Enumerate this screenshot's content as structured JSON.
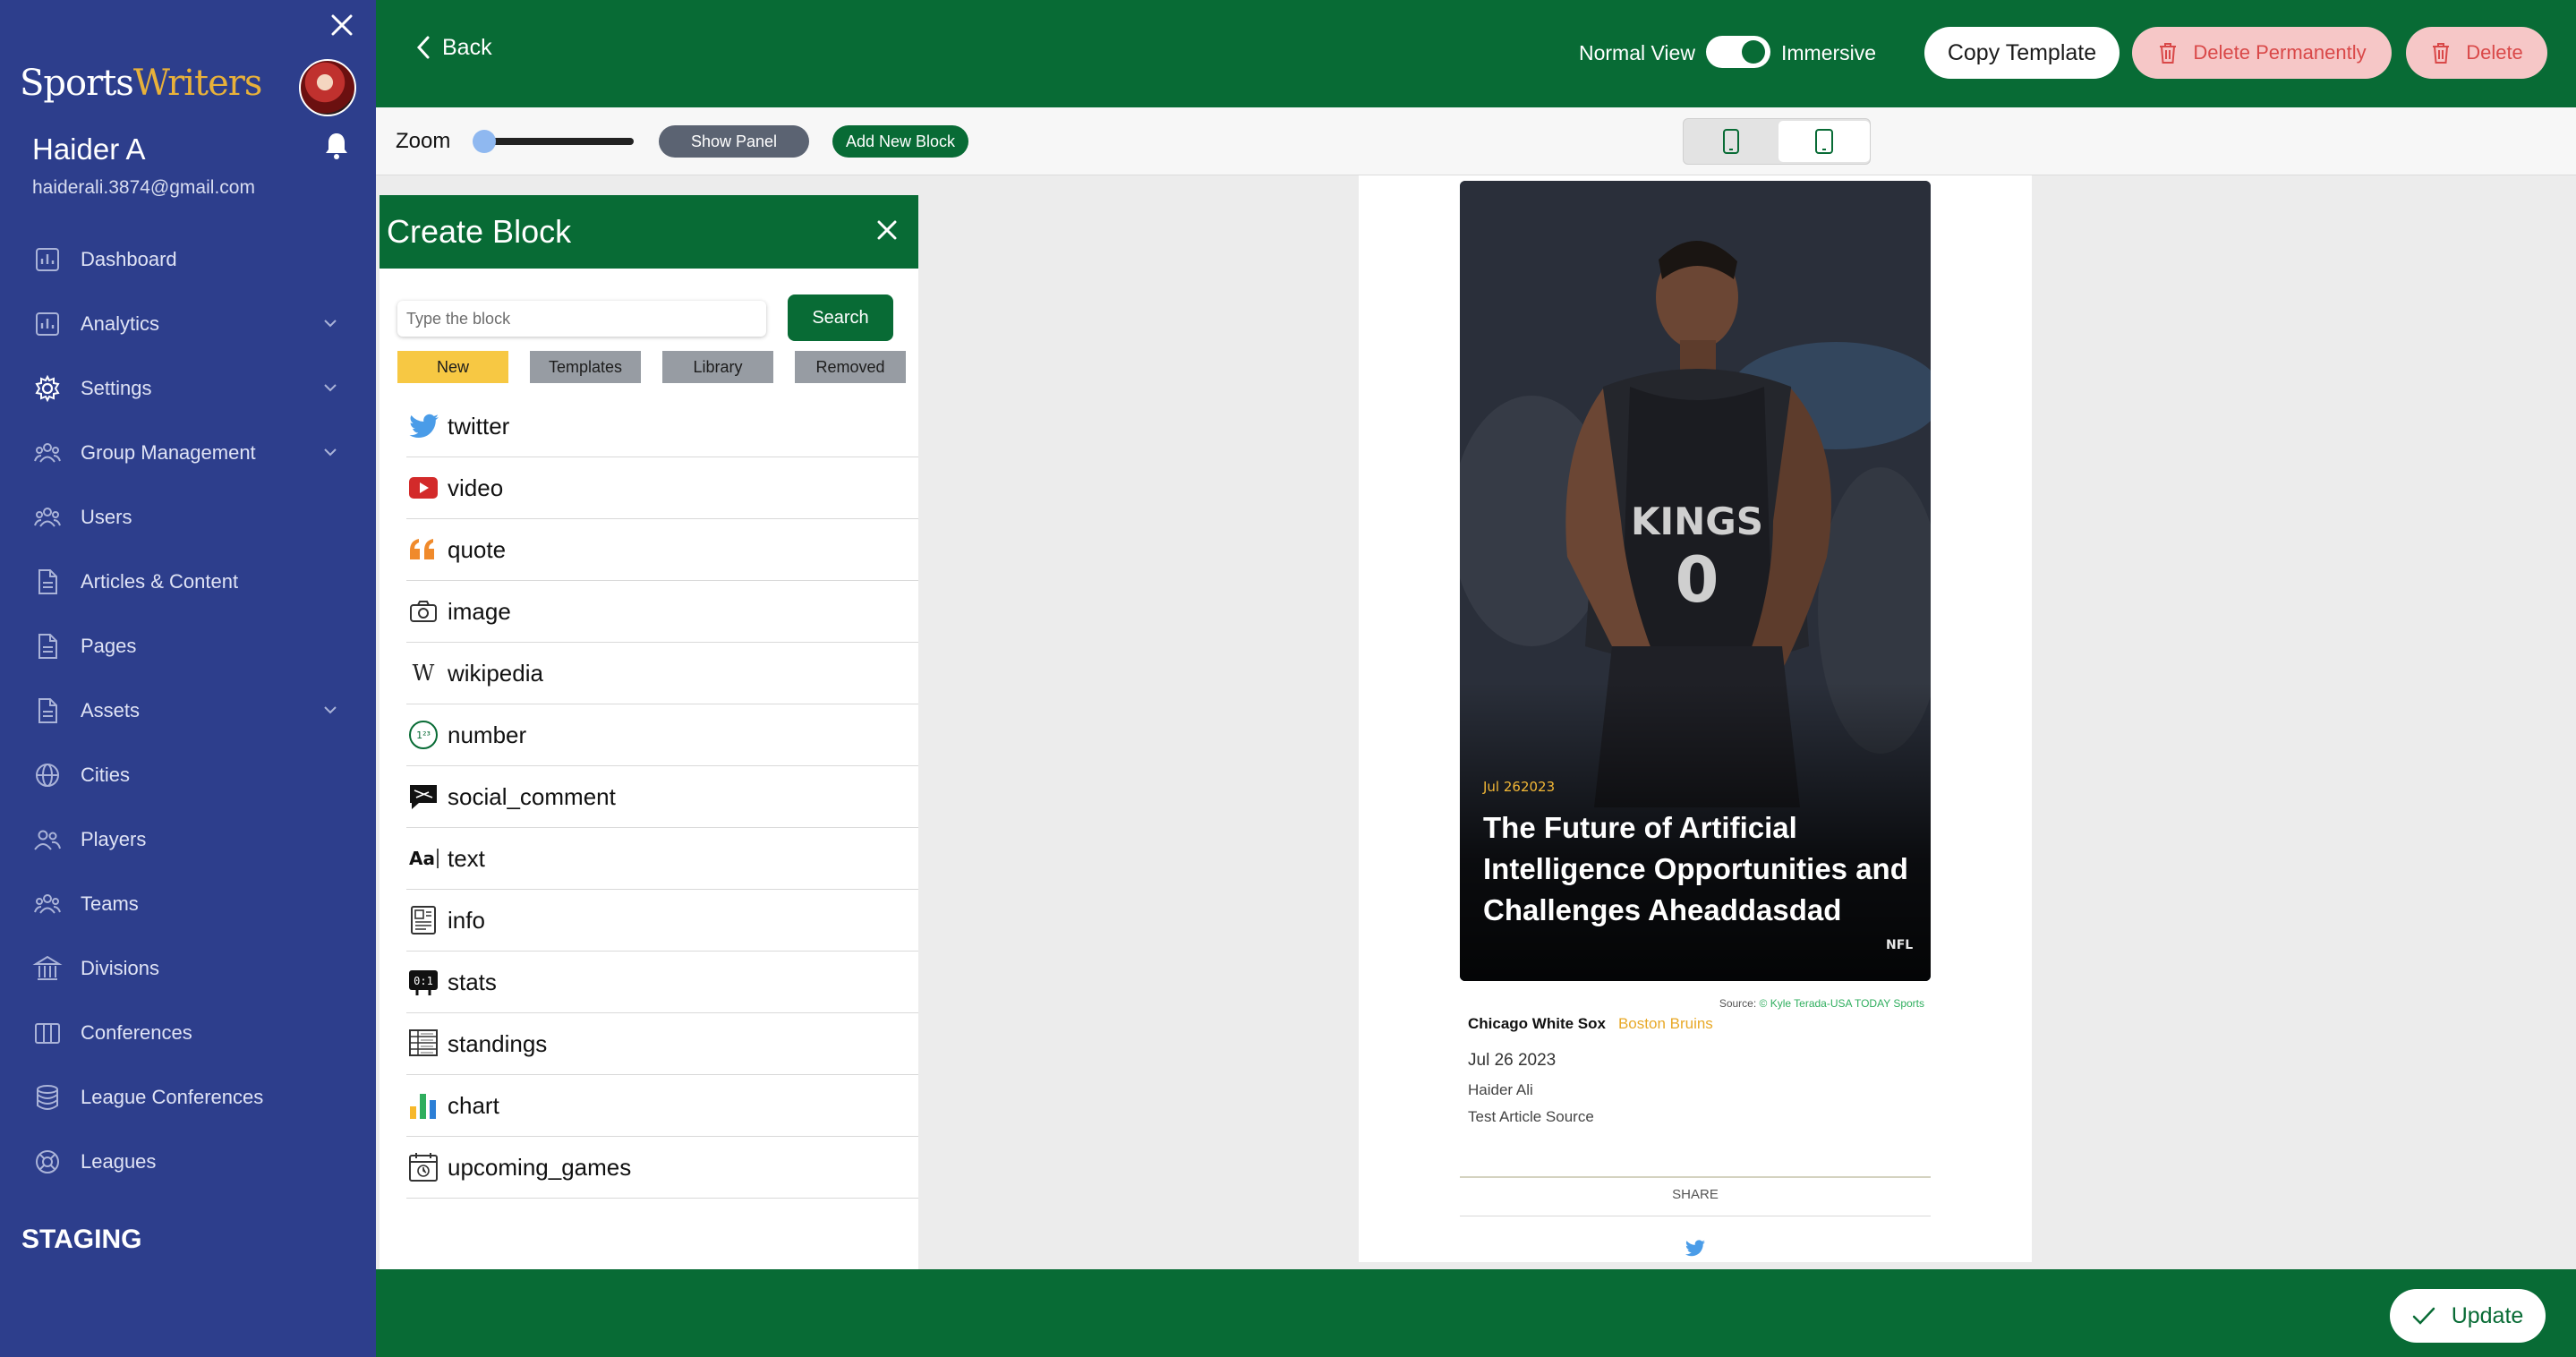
{
  "sidebar": {
    "brand_part1": "Sports",
    "brand_part2": "Writers",
    "user_name": "Haider A",
    "user_email": "haiderali.3874@gmail.com",
    "items": [
      {
        "label": "Dashboard",
        "icon": "chart-bar-icon",
        "expandable": false
      },
      {
        "label": "Analytics",
        "icon": "chart-bar-icon",
        "expandable": true
      },
      {
        "label": "Settings",
        "icon": "gear-icon",
        "expandable": true
      },
      {
        "label": "Group Management",
        "icon": "group-icon",
        "expandable": true
      },
      {
        "label": "Users",
        "icon": "group-icon",
        "expandable": false
      },
      {
        "label": "Articles & Content",
        "icon": "document-icon",
        "expandable": false
      },
      {
        "label": "Pages",
        "icon": "document-icon",
        "expandable": false
      },
      {
        "label": "Assets",
        "icon": "document-icon",
        "expandable": true
      },
      {
        "label": "Cities",
        "icon": "globe-icon",
        "expandable": false
      },
      {
        "label": "Players",
        "icon": "users-icon",
        "expandable": false
      },
      {
        "label": "Teams",
        "icon": "group-icon",
        "expandable": false
      },
      {
        "label": "Divisions",
        "icon": "building-icon",
        "expandable": false
      },
      {
        "label": "Conferences",
        "icon": "columns-icon",
        "expandable": false
      },
      {
        "label": "League Conferences",
        "icon": "database-icon",
        "expandable": false
      },
      {
        "label": "Leagues",
        "icon": "lifebuoy-icon",
        "expandable": false
      }
    ],
    "environment": "STAGING"
  },
  "topbar": {
    "back_label": "Back",
    "normal_view_label": "Normal View",
    "immersive_label": "Immersive",
    "immersive_on": true,
    "copy_template_label": "Copy Template",
    "delete_permanently_label": "Delete Permanently",
    "delete_label": "Delete"
  },
  "toolbar": {
    "zoom_label": "Zoom",
    "zoom_value": 0,
    "show_panel_label": "Show Panel",
    "add_block_label": "Add New Block",
    "device_selected": "tablet"
  },
  "create_block": {
    "title": "Create Block",
    "search_placeholder": "Type the block",
    "search_button": "Search",
    "tabs": [
      "New",
      "Templates",
      "Library",
      "Removed"
    ],
    "active_tab": "New",
    "blocks": [
      {
        "label": "twitter",
        "icon": "twitter-icon"
      },
      {
        "label": "video",
        "icon": "youtube-icon"
      },
      {
        "label": "quote",
        "icon": "quote-icon"
      },
      {
        "label": "image",
        "icon": "camera-icon"
      },
      {
        "label": "wikipedia",
        "icon": "wikipedia-icon"
      },
      {
        "label": "number",
        "icon": "number-icon"
      },
      {
        "label": "social_comment",
        "icon": "comment-icon"
      },
      {
        "label": "text",
        "icon": "text-icon"
      },
      {
        "label": "info",
        "icon": "info-icon"
      },
      {
        "label": "stats",
        "icon": "scoreboard-icon"
      },
      {
        "label": "standings",
        "icon": "standings-icon"
      },
      {
        "label": "chart",
        "icon": "bar-chart-icon"
      },
      {
        "label": "upcoming_games",
        "icon": "calendar-icon"
      }
    ]
  },
  "preview": {
    "date_badge": "Jul 262023",
    "title": "The Future of Artificial Intelligence Opportunities and Challenges Aheaddasdad",
    "tag": "NFL",
    "source_prefix": "Source:",
    "source_credit": "© Kyle Terada-USA TODAY Sports",
    "team1": "Chicago White Sox",
    "team2": "Boston Bruins",
    "date": "Jul 26 2023",
    "author": "Haider Ali",
    "article_source": "Test Article Source",
    "share_label": "SHARE"
  },
  "bottombar": {
    "update_label": "Update"
  },
  "colors": {
    "sidebar_bg": "#2d3e8c",
    "primary_green": "#086b35",
    "brand_accent": "#e8b13a",
    "danger_bg": "#f6c7c7",
    "danger_text": "#d94848",
    "tab_active": "#f7c843"
  }
}
